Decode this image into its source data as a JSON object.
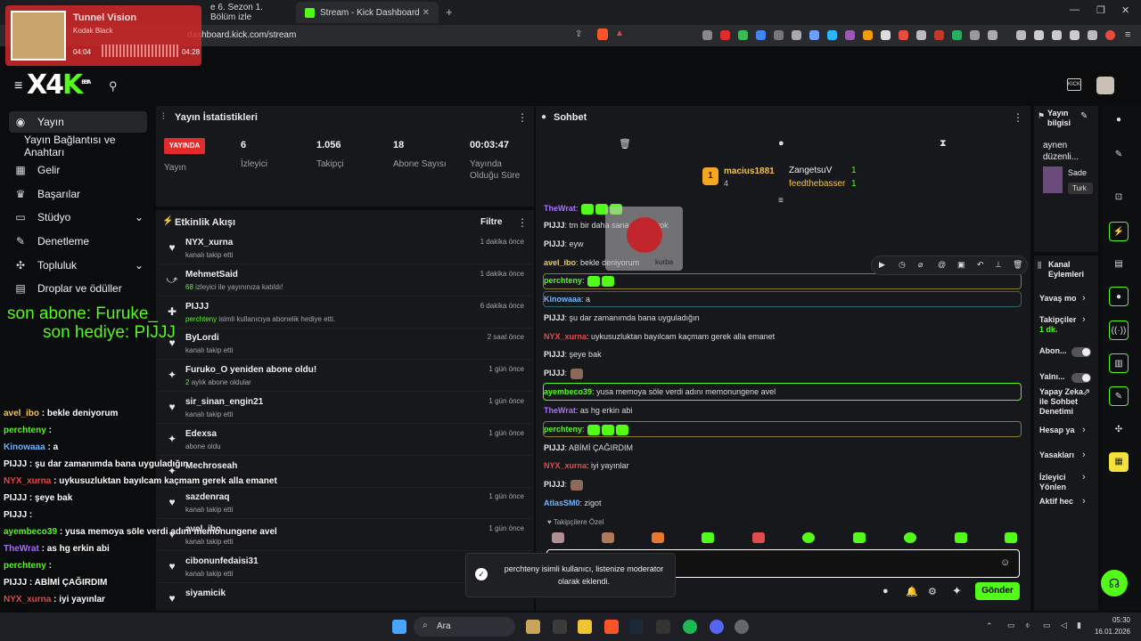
{
  "browser": {
    "tabs": [
      {
        "label": "e 6. Sezon 1. Bölüm izle"
      },
      {
        "label": "Stream - Kick Dashboard"
      }
    ],
    "url": "dashboard.kick.com/stream"
  },
  "media": {
    "title": "Tunnel Vision",
    "artist": "Kodak Black",
    "elapsed": "04:04",
    "total": "04:28"
  },
  "overlay": {
    "line1": "son abone: Furuke_",
    "line2": "son hediye: PIJJJ"
  },
  "sidebar": {
    "logo": "X4",
    "logo_tag": "BETA",
    "items": [
      {
        "label": "Yayın",
        "icon": "broadcast-icon"
      },
      {
        "label": "Yayın Bağlantısı ve Anahtarı",
        "icon": ""
      },
      {
        "label": "Gelir",
        "icon": "dollar-icon"
      },
      {
        "label": "Başarılar",
        "icon": "trophy-icon"
      },
      {
        "label": "Stüdyo",
        "icon": "studio-icon"
      },
      {
        "label": "Denetleme",
        "icon": "wrench-icon"
      },
      {
        "label": "Topluluk",
        "icon": "community-icon"
      },
      {
        "label": "Droplar ve ödüller",
        "icon": "gift-icon"
      }
    ]
  },
  "stats": {
    "title": "Yayın İstatistikleri",
    "live_badge": "YAYINDA",
    "live_label": "Yayın",
    "cols": [
      {
        "value": "6",
        "label": "İzleyici"
      },
      {
        "value": "1.056",
        "label": "Takipçi"
      },
      {
        "value": "18",
        "label": "Abone Sayısı"
      },
      {
        "value": "00:03:47",
        "label": "Yayında Olduğu Süre"
      }
    ]
  },
  "feed": {
    "title": "Etkinlik Akışı",
    "filter": "Filtre",
    "rows": [
      {
        "name": "NYX_xurna",
        "desc": "kanalı takip etti",
        "time": "1 dakika önce",
        "icon": "heart-icon"
      },
      {
        "name": "MehmetSaid",
        "desc_hl": "68",
        "desc": "izleyici ile yayınınıza katıldı!",
        "time": "1 dakika önce",
        "icon": "raid-icon"
      },
      {
        "name": "PIJJJ",
        "desc_hl": "perchteny",
        "desc": "isimli kullanıcıya abonelik hediye etti.",
        "time": "6 dakika önce",
        "icon": "gift-icon"
      },
      {
        "name": "ByLordi",
        "desc": "kanalı takip etti",
        "time": "2 saat önce",
        "icon": "heart-icon"
      },
      {
        "name": "Furuko_O yeniden abone oldu!",
        "desc_hl": "2",
        "desc": "aylık abone oldular",
        "time": "1 gün önce",
        "icon": "star-icon"
      },
      {
        "name": "sir_sinan_engin21",
        "desc": "kanalı takip etti",
        "time": "1 gün önce",
        "icon": "heart-icon"
      },
      {
        "name": "Edexsa",
        "desc": "abone oldu",
        "time": "1 gün önce",
        "icon": "star-icon"
      },
      {
        "name": "Mechroseah",
        "desc": "",
        "time": "",
        "icon": "star-icon"
      },
      {
        "name": "sazdenraq",
        "desc": "kanalı takip etti",
        "time": "1 gün önce",
        "icon": "heart-icon"
      },
      {
        "name": "avel_ibo",
        "desc": "kanalı takip etti",
        "time": "1 gün önce",
        "icon": "heart-icon"
      },
      {
        "name": "cibonunfedaisi31",
        "desc": "kanalı takip etti",
        "time": "1 gün önce",
        "icon": "heart-icon"
      },
      {
        "name": "siyamicik",
        "desc": "",
        "time": "",
        "icon": "heart-icon"
      }
    ]
  },
  "chat": {
    "title": "Sohbet",
    "leader": {
      "rank": "1",
      "name": "macius1881",
      "count": "4"
    },
    "leader2": [
      {
        "name": "ZangetsuV",
        "count": "1"
      },
      {
        "name": "feedthebasser",
        "count": "1"
      }
    ],
    "messages": [
      {
        "user": "TheWrat",
        "text": "",
        "color": "#a970ff"
      },
      {
        "user": "PIJJJ",
        "text": "tm bir daha sana abone yok",
        "color": "#e8e8e8"
      },
      {
        "user": "PIJJJ",
        "text": "eyw",
        "color": "#e8e8e8"
      },
      {
        "user": "avel_ibo",
        "text": "bekle deniyorum",
        "color": "#f2c94c"
      },
      {
        "user": "perchteny",
        "text": "",
        "color": "#53fc18"
      },
      {
        "user": "Kinowaaa",
        "text": "a",
        "color": "#6fb6ff"
      },
      {
        "user": "PIJJJ",
        "text": "şu dar zamanımda bana uyguladığın",
        "color": "#e8e8e8"
      },
      {
        "user": "NYX_xurna",
        "text": "uykusuzluktan bayılcam kaçmam gerek alla emanet",
        "color": "#e24b4b"
      },
      {
        "user": "PIJJJ",
        "text": "şeye bak",
        "color": "#e8e8e8"
      },
      {
        "user": "PIJJJ",
        "text": "",
        "color": "#e8e8e8"
      },
      {
        "user": "ayembeco39",
        "text": "yusa memoya söle verdi adını memonungene avel",
        "color": "#53fc18"
      },
      {
        "user": "TheWrat",
        "text": "as hg erkin abi",
        "color": "#a970ff"
      },
      {
        "user": "perchteny",
        "text": "",
        "color": "#53fc18"
      },
      {
        "user": "PIJJJ",
        "text": "ABİMİ ÇAĞIRDIM",
        "color": "#e8e8e8"
      },
      {
        "user": "NYX_xurna",
        "text": "iyi yayınlar",
        "color": "#e24b4b"
      },
      {
        "user": "PIJJJ",
        "text": "",
        "color": "#e8e8e8"
      },
      {
        "user": "AtlasSM0",
        "text": "zigot",
        "color": "#6fb6ff"
      }
    ],
    "emote_popup_label": "kurba",
    "followers_only": "Takipçilere Özel",
    "toast": "perchteny isimli kullanıcı, listenize moderator olarak eklendi.",
    "send": "Gönder"
  },
  "stream_info": {
    "title": "Yayın bilgisi",
    "desc": "aynen düzenli...",
    "tag1": "Sade",
    "tag2": "Turk"
  },
  "channel_actions": {
    "title": "Kanal Eylemleri",
    "items": [
      {
        "label": "Yavaş mo"
      },
      {
        "label": "Takipçiler",
        "sub": "1 dk."
      },
      {
        "label": "Abon..."
      },
      {
        "label": "Yalnı..."
      },
      {
        "label": "Yapay Zeka ile Sohbet Denetimi"
      },
      {
        "label": "Hesap ya"
      },
      {
        "label": "Yasakları"
      },
      {
        "label": "İzleyici Yönlen"
      },
      {
        "label": "Aktif hec"
      }
    ]
  },
  "overlay_chat": [
    {
      "user": "avel_ibo",
      "text": "bekle deniyorum",
      "color": "#f2c94c"
    },
    {
      "user": "perchteny",
      "text": "",
      "color": "#53fc18"
    },
    {
      "user": "Kinowaaa",
      "text": "a",
      "color": "#6fb6ff"
    },
    {
      "user": "PIJJJ",
      "text": "şu dar zamanımda bana uyguladığın",
      "color": "#ffffff"
    },
    {
      "user": "NYX_xurna",
      "text": "uykusuzluktan bayılcam kaçmam gerek alla emanet",
      "color": "#e24b4b"
    },
    {
      "user": "PIJJJ",
      "text": "şeye bak",
      "color": "#ffffff"
    },
    {
      "user": "PIJJJ",
      "text": "",
      "color": "#ffffff"
    },
    {
      "user": "ayembeco39",
      "text": "yusa memoya söle verdi adını memonungene avel",
      "color": "#53fc18"
    },
    {
      "user": "TheWrat",
      "text": "as hg erkin abi",
      "color": "#a970ff"
    },
    {
      "user": "perchteny",
      "text": "",
      "color": "#53fc18"
    },
    {
      "user": "PIJJJ",
      "text": "ABİMİ ÇAĞIRDIM",
      "color": "#ffffff"
    },
    {
      "user": "NYX_xurna",
      "text": "iyi yayınlar",
      "color": "#e24b4b"
    },
    {
      "user": "PIJJJ",
      "text": "",
      "color": "#ffffff"
    },
    {
      "user": "AtlasSM0",
      "text": "zigot",
      "color": "#ffffff"
    }
  ],
  "taskbar": {
    "search": "Ara",
    "time": "05:30",
    "date": "16.01.2026"
  }
}
